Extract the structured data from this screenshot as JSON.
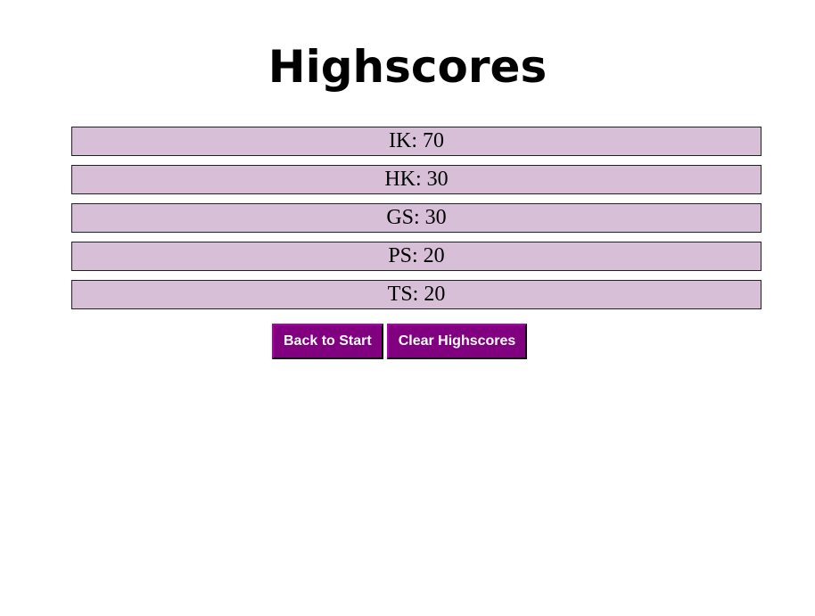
{
  "header": {
    "title": "Highscores"
  },
  "scores": [
    {
      "text": "IK: 70"
    },
    {
      "text": "HK: 30"
    },
    {
      "text": "GS: 30"
    },
    {
      "text": "PS: 20"
    },
    {
      "text": "TS: 20"
    }
  ],
  "actions": {
    "back_label": "Back to Start",
    "clear_label": "Clear Highscores"
  },
  "colors": {
    "row_background": "#d8bfd8",
    "button_background": "#800080",
    "button_text": "#ffffff"
  }
}
